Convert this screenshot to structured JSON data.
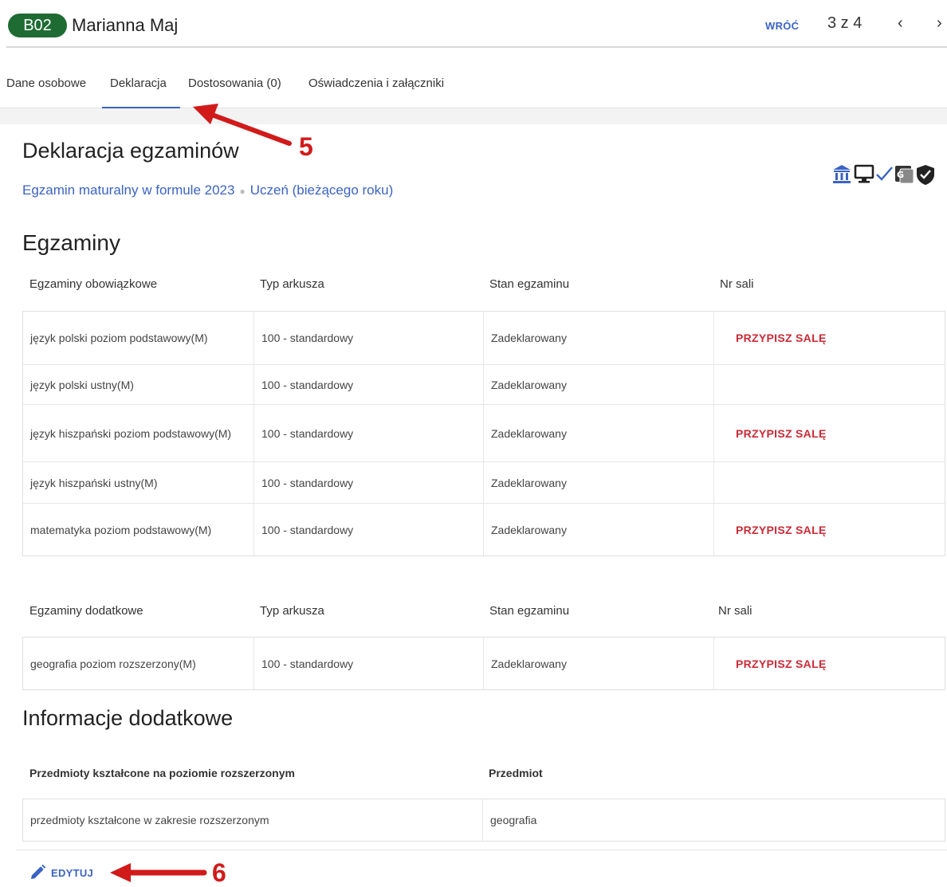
{
  "header": {
    "badge": "B02",
    "student_name": "Marianna Maj",
    "back_label": "WRÓĆ",
    "counter": "3 z 4",
    "prev_icon": "‹",
    "next_icon": "›"
  },
  "tabs": [
    {
      "label": "Dane osobowe",
      "active": false
    },
    {
      "label": "Deklaracja",
      "active": true
    },
    {
      "label": "Dostosowania (0)",
      "active": false
    },
    {
      "label": "Oświadczenia i załączniki",
      "active": false
    }
  ],
  "annotations": {
    "tab_marker": "5",
    "edit_marker": "6",
    "color": "#d11a1a"
  },
  "declaration": {
    "title": "Deklaracja egzaminów",
    "exam_formula": "Egzamin maturalny w formule 2023",
    "separator": "●",
    "student_type": "Uczeń (bieżącego roku)",
    "status_icons": [
      "bank-icon",
      "monitor-icon",
      "check-icon",
      "translate-icon",
      "shield-check-icon"
    ]
  },
  "exams": {
    "title": "Egzaminy",
    "mandatory": {
      "headers": [
        "Egzaminy obowiązkowe",
        "Typ arkusza",
        "Stan egzaminu",
        "Nr sali"
      ],
      "rows": [
        {
          "subject": "język polski poziom podstawowy(M)",
          "sheet": "100 - standardowy",
          "state": "Zadeklarowany",
          "room": "PRZYPISZ SALĘ"
        },
        {
          "subject": "język polski ustny(M)",
          "sheet": "100 - standardowy",
          "state": "Zadeklarowany",
          "room": ""
        },
        {
          "subject": "język hiszpański poziom podstawowy(M)",
          "sheet": "100 - standardowy",
          "state": "Zadeklarowany",
          "room": "PRZYPISZ SALĘ"
        },
        {
          "subject": "język hiszpański ustny(M)",
          "sheet": "100 - standardowy",
          "state": "Zadeklarowany",
          "room": ""
        },
        {
          "subject": "matematyka poziom podstawowy(M)",
          "sheet": "100 - standardowy",
          "state": "Zadeklarowany",
          "room": "PRZYPISZ SALĘ"
        }
      ]
    },
    "additional": {
      "headers": [
        "Egzaminy dodatkowe",
        "Typ arkusza",
        "Stan egzaminu",
        "Nr sali"
      ],
      "rows": [
        {
          "subject": "geografia poziom rozszerzony(M)",
          "sheet": "100 - standardowy",
          "state": "Zadeklarowany",
          "room": "PRZYPISZ SALĘ"
        }
      ]
    }
  },
  "info": {
    "title": "Informacje dodatkowe",
    "headers": [
      "Przedmioty kształcone na poziomie rozszerzonym",
      "Przedmiot"
    ],
    "rows": [
      {
        "label": "przedmioty kształcone w zakresie rozszerzonym",
        "value": "geografia"
      }
    ]
  },
  "edit": {
    "label": "EDYTUJ",
    "icon": "pencil-icon"
  },
  "colors": {
    "accent": "#3b63c4",
    "badge": "#1e6b34",
    "danger": "#cc2a36"
  }
}
